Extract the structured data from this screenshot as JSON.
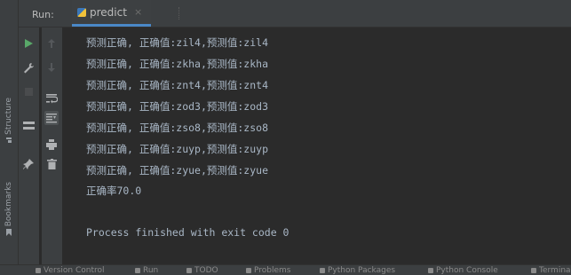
{
  "run_header": {
    "run_label": "Run:",
    "tab_label": "predict",
    "close_glyph": "×"
  },
  "side_stripe": {
    "structure_label": "Structure",
    "bookmarks_label": "Bookmarks"
  },
  "toolbar_left": [
    "run-icon",
    "wrench-icon",
    "stop-icon",
    "layout-icon",
    "pin-icon"
  ],
  "toolbar_right": [
    "up-arrow-icon",
    "down-arrow-icon",
    "soft-wrap-icon",
    "scroll-to-end-icon",
    "print-icon",
    "trash-icon"
  ],
  "console": {
    "lines": [
      "预测正确, 正确值:zil4,预测值:zil4",
      "预测正确, 正确值:zkha,预测值:zkha",
      "预测正确, 正确值:znt4,预测值:znt4",
      "预测正确, 正确值:zod3,预测值:zod3",
      "预测正确, 正确值:zso8,预测值:zso8",
      "预测正确, 正确值:zuyp,预测值:zuyp",
      "预测正确, 正确值:zyue,预测值:zyue",
      "正确率70.0"
    ],
    "process_line": "Process finished with exit code 0"
  },
  "bottom_bar": {
    "items": [
      "Version Control",
      "Run",
      "TODO",
      "Problems",
      "Python Packages",
      "Python Console",
      "Terminal"
    ]
  },
  "colors": {
    "console_bg": "#2b2b2b",
    "panel_bg": "#3c3f41",
    "text": "#a9b7c6",
    "run_green": "#59a869",
    "accent_blue": "#4a88c7"
  }
}
